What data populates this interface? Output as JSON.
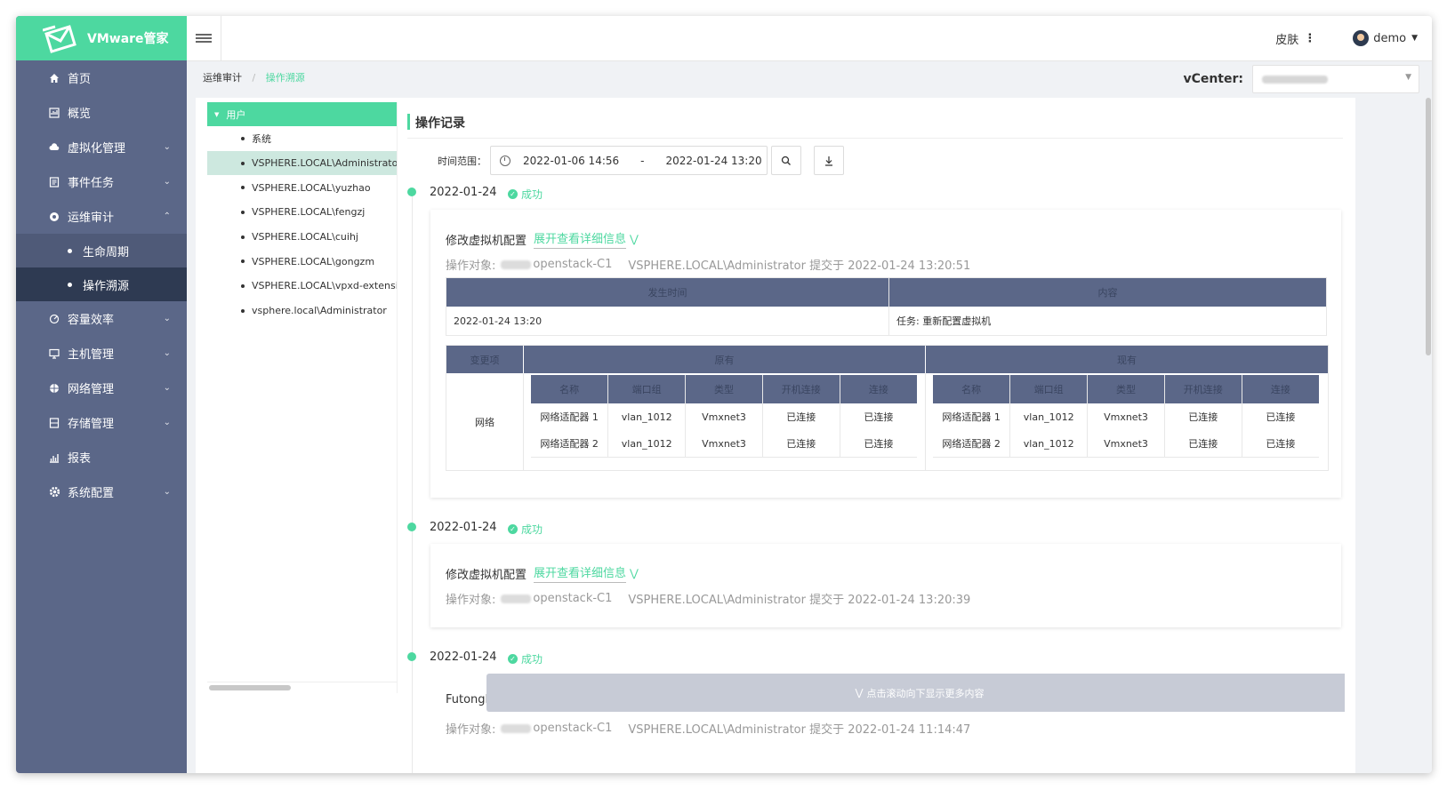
{
  "brand": {
    "name": "VMware管家",
    "color": "#4dd8a0"
  },
  "sidebar": {
    "items": [
      {
        "label": "首页",
        "icon": "home-icon"
      },
      {
        "label": "概览",
        "icon": "overview-icon"
      },
      {
        "label": "虚拟化管理",
        "icon": "cloud-icon",
        "expandable": true
      },
      {
        "label": "事件任务",
        "icon": "task-icon",
        "expandable": true
      },
      {
        "label": "运维审计",
        "icon": "audit-icon",
        "expandable": true,
        "expanded": true
      },
      {
        "label": "容量效率",
        "icon": "capacity-icon",
        "expandable": true
      },
      {
        "label": "主机管理",
        "icon": "host-icon",
        "expandable": true
      },
      {
        "label": "网络管理",
        "icon": "network-icon",
        "expandable": true
      },
      {
        "label": "存储管理",
        "icon": "storage-icon",
        "expandable": true
      },
      {
        "label": "报表",
        "icon": "report-icon"
      },
      {
        "label": "系统配置",
        "icon": "gear-icon",
        "expandable": true
      }
    ],
    "audit_sub": [
      {
        "label": "生命周期"
      },
      {
        "label": "操作溯源",
        "active": true
      }
    ]
  },
  "topbar": {
    "skin_label": "皮肤",
    "user_name": "demo"
  },
  "breadcrumb": {
    "parent": "运维审计",
    "sep": "/",
    "current": "操作溯源"
  },
  "vcenter": {
    "label": "vCenter:"
  },
  "tree": {
    "root": "用户",
    "items": [
      "系统",
      "VSPHERE.LOCAL\\Administrator",
      "VSPHERE.LOCAL\\yuzhao",
      "VSPHERE.LOCAL\\fengzj",
      "VSPHERE.LOCAL\\cuihj",
      "VSPHERE.LOCAL\\gongzm",
      "VSPHERE.LOCAL\\vpxd-extension-",
      "vsphere.local\\Administrator"
    ],
    "selected_index": 1
  },
  "records": {
    "title": "操作记录",
    "filter_label": "时间范围：",
    "start": "2022-01-06 14:56",
    "dash": "-",
    "end": "2022-01-24 13:20",
    "load_more": "点击滚动向下显示更多内容",
    "entries": [
      {
        "date": "2022-01-24",
        "status": "成功",
        "action": "修改虚拟机配置",
        "expand": "展开查看详细信息",
        "target_label": "操作对象:",
        "target": "openstack-C1",
        "submitter": "VSPHERE.LOCAL\\Administrator 提交于 2022-01-24 13:20:51",
        "detail": {
          "head": [
            "发生时间",
            "内容"
          ],
          "row": [
            "2022-01-24 13:20",
            "任务: 重新配置虚拟机"
          ]
        },
        "changes": {
          "item_head": "变更项",
          "before_head": "原有",
          "after_head": "现有",
          "cols": [
            "名称",
            "端口组",
            "类型",
            "开机连接",
            "连接"
          ],
          "item": "网络",
          "before": [
            [
              "网络适配器 1",
              "vlan_1012",
              "Vmxnet3",
              "已连接",
              "已连接"
            ],
            [
              "网络适配器 2",
              "vlan_1012",
              "Vmxnet3",
              "已连接",
              "已连接"
            ]
          ],
          "after": [
            [
              "网络适配器 1",
              "vlan_1012",
              "Vmxnet3",
              "已连接",
              "已连接"
            ],
            [
              "网络适配器 2",
              "vlan_1012",
              "Vmxnet3",
              "已连接",
              "已连接"
            ]
          ]
        }
      },
      {
        "date": "2022-01-24",
        "status": "成功",
        "action": "修改虚拟机配置",
        "expand": "展开查看详细信息",
        "target_label": "操作对象:",
        "target": "openstack-C1",
        "submitter": "VSPHERE.LOCAL\\Administrator 提交于 2022-01-24 13:20:39"
      },
      {
        "date": "2022-01-24",
        "status": "成功",
        "action": "FutongI",
        "target_label": "操作对象:",
        "target": "openstack-C1",
        "submitter": "VSPHERE.LOCAL\\Administrator 提交于 2022-01-24 11:14:47"
      }
    ]
  }
}
